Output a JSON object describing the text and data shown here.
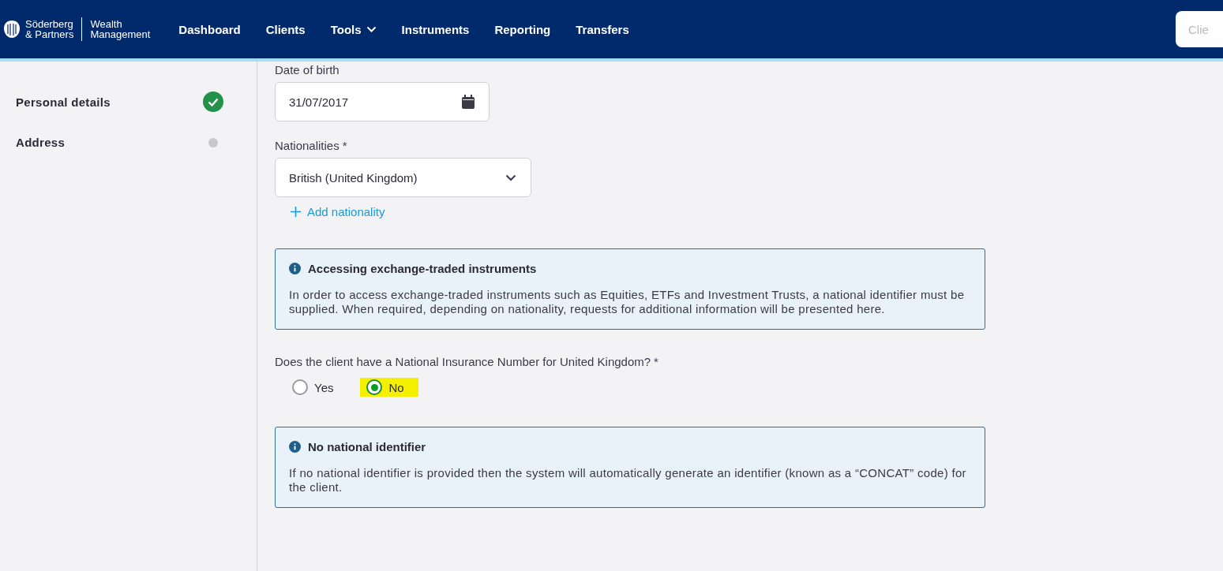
{
  "header": {
    "logo": {
      "brand_line_1": "Söderberg",
      "brand_line_2": "& Partners",
      "product_line_1": "Wealth",
      "product_line_2": "Management"
    },
    "nav": [
      {
        "label": "Dashboard",
        "has_dropdown": false
      },
      {
        "label": "Clients",
        "has_dropdown": false
      },
      {
        "label": "Tools",
        "has_dropdown": true
      },
      {
        "label": "Instruments",
        "has_dropdown": false
      },
      {
        "label": "Reporting",
        "has_dropdown": false
      },
      {
        "label": "Transfers",
        "has_dropdown": false
      }
    ],
    "search": {
      "placeholder": "Clie"
    }
  },
  "sidebar": {
    "steps": [
      {
        "label": "Personal details",
        "completed": true
      },
      {
        "label": "Address",
        "completed": false
      }
    ]
  },
  "form": {
    "date_of_birth": {
      "label": "Date of birth",
      "value": "31/07/2017"
    },
    "nationalities": {
      "label": "Nationalities",
      "required_mark": "*",
      "value": "British (United Kingdom)"
    },
    "add_link": "Add nationality",
    "notices": [
      {
        "title": "Accessing exchange-traded instruments",
        "body": "In order to access exchange-traded instruments such as Equities, ETFs and Investment Trusts, a national identifier must be supplied. When required, depending on nationality, requests for additional information will be presented here."
      }
    ],
    "question": {
      "label": "Does the client have a National Insurance Number for United Kingdom?",
      "required_mark": "*",
      "options": [
        {
          "label": "Yes",
          "selected": false,
          "highlighted": false
        },
        {
          "label": "No",
          "selected": true,
          "highlighted": true
        }
      ]
    },
    "notices_after": [
      {
        "title": "No national identifier",
        "body": "If no national identifier is provided then the system will automatically generate an identifier (known as a “CONCAT” code) for the client."
      }
    ]
  }
}
